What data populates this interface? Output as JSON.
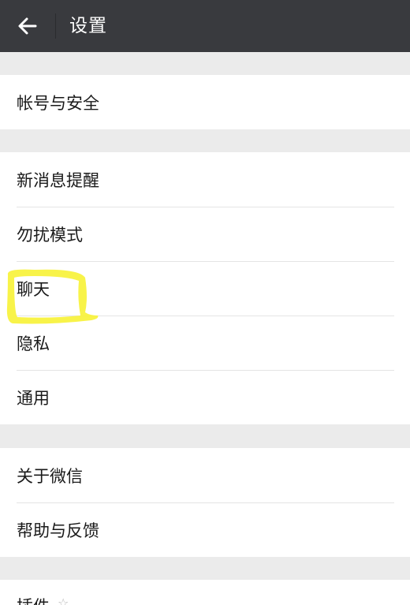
{
  "header": {
    "title": "设置",
    "back_icon": "arrow-left-icon",
    "background": "#393a3e"
  },
  "groups": [
    {
      "items": [
        {
          "label": "帐号与安全"
        }
      ]
    },
    {
      "items": [
        {
          "label": "新消息提醒"
        },
        {
          "label": "勿扰模式"
        },
        {
          "label": "聊天",
          "highlighted": true
        },
        {
          "label": "隐私"
        },
        {
          "label": "通用"
        }
      ]
    },
    {
      "items": [
        {
          "label": "关于微信"
        },
        {
          "label": "帮助与反馈"
        }
      ]
    },
    {
      "items": [
        {
          "label": "插件",
          "icon": "star-icon"
        }
      ]
    }
  ],
  "colors": {
    "highlight": "#f7f23a",
    "page_background": "#ebebeb"
  }
}
